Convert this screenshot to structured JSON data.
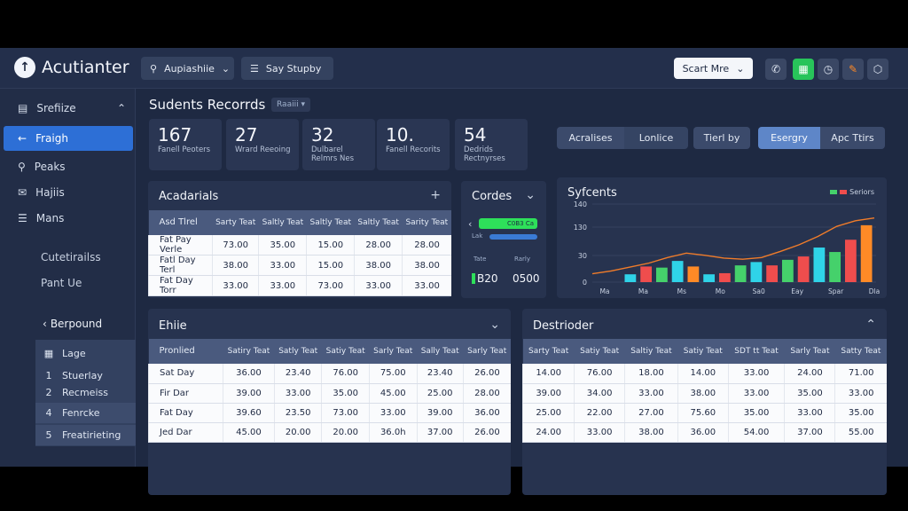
{
  "app": {
    "title": "Acutianter"
  },
  "topbar": {
    "search_label": "Aupiashiie",
    "study_label": "Say Stupby",
    "white_button": "Scart Mre"
  },
  "sidebar": {
    "section": "Srefiize",
    "items": [
      {
        "label": "Fraigh",
        "icon": "←"
      },
      {
        "label": "Peaks",
        "icon": "⚲"
      },
      {
        "label": "Hajiis",
        "icon": "✉"
      },
      {
        "label": "Mans",
        "icon": "☰"
      }
    ],
    "sub1": "Cutetirailss",
    "sub2": "Pant Ue",
    "back_label": "Berpound",
    "logs_label": "Lage",
    "logs": [
      {
        "num": "1",
        "label": "Stuerlay"
      },
      {
        "num": "2",
        "label": "Recmeiss"
      },
      {
        "num": "4",
        "label": "Fenrcke"
      },
      {
        "num": "5",
        "label": "Freatirieting"
      }
    ]
  },
  "main": {
    "title": "Sudents Recorrds",
    "tag": "Raaiii ▾"
  },
  "stats": [
    {
      "value": "167",
      "label": "Fanell Peoters"
    },
    {
      "value": "27",
      "label": "Wrard Reeoing"
    },
    {
      "value": "32",
      "label": "Dulbarel Relmrs Nes"
    },
    {
      "value": "10.",
      "label": "Fanell Recorits"
    },
    {
      "value": "54",
      "label": "Dedrids Rectnyrses"
    }
  ],
  "controls": {
    "seg1_a": "Acralises",
    "seg1_b": "Lonlice",
    "filter": "Tierl by",
    "seg2_a": "Esergry",
    "seg2_b": "Apc Ttirs"
  },
  "academic": {
    "title": "Acadarials",
    "add": "+",
    "headers": [
      "Asd Tlrel",
      "Sarty Teat",
      "Saltly Teat",
      "Saltly Teat",
      "Saltly Teat",
      "Sarity Teat"
    ],
    "rows": [
      [
        "Fat Pay  Verle",
        "73.00",
        "35.00",
        "15.00",
        "28.00",
        "28.00"
      ],
      [
        "Fatl Day  Terl",
        "38.00",
        "33.00",
        "15.00",
        "38.00",
        "38.00"
      ],
      [
        "Fat Day  Torr",
        "33.00",
        "33.00",
        "73.00",
        "33.00",
        "33.00"
      ]
    ]
  },
  "codes": {
    "title": "Cordes",
    "chevron": "⌄",
    "arrow": "‹",
    "green_value": "C0B3 Ca",
    "bar_label": "Lak",
    "left_label": "Tate",
    "right_label": "Rarly",
    "left_value": "B20",
    "right_value": "0500"
  },
  "chart": {
    "title": "Syfcents",
    "legend": "Seriors",
    "colors": {
      "teal": "#2fd3e8",
      "red": "#ef4d4d",
      "green": "#45d16b",
      "orange": "#ff8a26",
      "line": "#f07c2a"
    }
  },
  "chart_data": {
    "type": "bar",
    "title": "Syfcents",
    "categories": [
      "Ma",
      "Ma",
      "Ms",
      "Mo",
      "Sa0",
      "Eay",
      "Spar",
      "Dla"
    ],
    "yticks": [
      "0",
      "30",
      "130",
      "140"
    ],
    "ylim": [
      0,
      140
    ],
    "values": [
      14,
      28,
      26,
      38,
      28,
      14,
      16,
      30,
      36,
      30,
      40,
      46,
      62,
      54,
      76,
      102
    ],
    "bar_colors": [
      "#2fd3e8",
      "#ef4d4d",
      "#45d16b",
      "#2fd3e8",
      "#ff8a26",
      "#2fd3e8",
      "#ef4d4d",
      "#45d16b",
      "#2fd3e8",
      "#ef4d4d",
      "#45d16b",
      "#ef4d4d",
      "#2fd3e8",
      "#45d16b",
      "#ef4d4d",
      "#ff8a26"
    ],
    "trend": [
      15,
      20,
      27,
      34,
      44,
      52,
      48,
      43,
      41,
      44,
      55,
      67,
      82,
      100,
      110,
      115
    ],
    "legend": [
      "Seriors"
    ]
  },
  "table2": {
    "title": "Ehiie",
    "headers": [
      "Pronlied",
      "Satiry Teat",
      "Satly Teat",
      "Satiy Teat",
      "Sarly Teat",
      "Sally Teat",
      "Sarly Teat"
    ],
    "rows": [
      [
        "Sat Day",
        "36.00",
        "23.40",
        "76.00",
        "75.00",
        "23.40",
        "26.00"
      ],
      [
        "Fir Dar",
        "39.00",
        "33.00",
        "35.00",
        "45.00",
        "25.00",
        "28.00"
      ],
      [
        "Fat Day",
        "39.60",
        "23.50",
        "73.00",
        "33.00",
        "39.00",
        "36.00"
      ],
      [
        "Jed Dar",
        "45.00",
        "20.00",
        "20.00",
        "36.0h",
        "37.00",
        "26.00"
      ]
    ]
  },
  "table3": {
    "title": "Destrioder",
    "headers": [
      "Sarty Teat",
      "Satiy Teat",
      "Saltiy Teat",
      "Satiy Teat",
      "SDT tt Teat",
      "Sarly Teat",
      "Satty Teat"
    ],
    "rows": [
      [
        "14.00",
        "76.00",
        "18.00",
        "14.00",
        "33.00",
        "24.00",
        "71.00"
      ],
      [
        "39.00",
        "34.00",
        "33.00",
        "38.00",
        "33.00",
        "35.00",
        "33.00"
      ],
      [
        "25.00",
        "22.00",
        "27.00",
        "75.60",
        "35.00",
        "33.00",
        "35.00"
      ],
      [
        "24.00",
        "33.00",
        "38.00",
        "36.00",
        "54.00",
        "37.00",
        "55.00"
      ]
    ]
  }
}
